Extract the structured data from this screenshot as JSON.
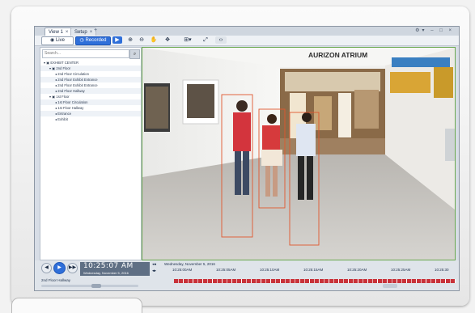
{
  "tabs": [
    {
      "label": "View 1",
      "close": "×"
    },
    {
      "label": "Setup",
      "close": "×"
    }
  ],
  "tab_add": "+",
  "window_controls": "⚙▾ – □ ×",
  "toolbar": {
    "live_label": "Live",
    "recorded_label": "Recorded",
    "tools": [
      "▶",
      "⊕",
      "⊖",
      "✋",
      "✥",
      "⊞▾",
      "⤢",
      "‹›"
    ]
  },
  "sidebar": {
    "search_placeholder": "Search...",
    "search_icon": "⌕",
    "tree": [
      {
        "label": "EXHIBIT CENTER",
        "level": 0,
        "icon": "▾ ▣"
      },
      {
        "label": "2nd Floor",
        "level": 1,
        "icon": "▾ ▣"
      },
      {
        "label": "2nd Floor Circulation",
        "level": 2,
        "icon": "◂"
      },
      {
        "label": "2nd Floor Exhibit Entrance",
        "level": 2,
        "icon": "◂"
      },
      {
        "label": "2nd Floor Exhibit Entrance",
        "level": 2,
        "icon": "◂"
      },
      {
        "label": "2nd Floor Hallway",
        "level": 2,
        "icon": "◂"
      },
      {
        "label": "1st Floor",
        "level": 1,
        "icon": "▾ ▣"
      },
      {
        "label": "1st Floor Circulation",
        "level": 2,
        "icon": "◂"
      },
      {
        "label": "1st Floor Hallway",
        "level": 2,
        "icon": "◂"
      },
      {
        "label": "Entrance",
        "level": 2,
        "icon": "◂"
      },
      {
        "label": "Exhibit",
        "level": 2,
        "icon": "◂"
      }
    ]
  },
  "video": {
    "sign_text": "AURIZON ATRIUM",
    "detection_color": "#e0572e"
  },
  "playback": {
    "time": "10:25:07 AM",
    "date": "Wednesday, November 5, 2016",
    "camera_label": "2nd Floor Hallway",
    "timeline_date": "Wednesday, November 5, 2016",
    "ticks": [
      "10:25:00AM",
      "10:25:05AM",
      "10:25:10AM",
      "10:25:15AM",
      "10:25:20AM",
      "10:25:25AM",
      "10:25:30"
    ],
    "buttons": [
      "◀",
      "▶",
      "▶▶"
    ]
  },
  "colors": {
    "accent": "#2f6fd9",
    "recording": "#c8323a"
  }
}
